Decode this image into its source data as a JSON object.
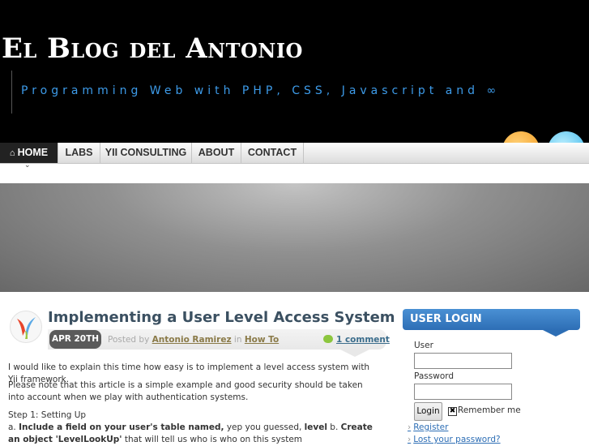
{
  "site": {
    "title": "El Blog del Antonio",
    "tagline": "Programming Web with PHP, CSS, Javascript and ∞"
  },
  "nav": {
    "items": [
      "HOME",
      "LABS",
      "YII CONSULTING",
      "ABOUT",
      "CONTACT"
    ],
    "active": "HOME"
  },
  "post": {
    "title": "Implementing a User Level Access System",
    "date": "APR 20TH",
    "posted_by_label": "Posted by",
    "author": "Antonio Ramirez",
    "in_label": "in",
    "category": "How To",
    "comments": "1 comment",
    "paragraphs": [
      "I would like to explain this time how easy is to implement a level access system with Yii framework.",
      "Please note that this article is a simple example and good security should be taken into account when we play with authentication systems."
    ],
    "step_heading": "Step 1: Setting Up",
    "step_parts": {
      "a_prefix": "a. ",
      "a_bold": "Include a field on your user's table named,",
      "a_text": " yep you guessed, ",
      "a_bold2": "level",
      "b_prefix": " b. ",
      "b_bold": "Create an object 'LevelLookUp'",
      "b_text": " that will tell us who is who on this system"
    }
  },
  "sidebar": {
    "widget_title": "USER LOGIN",
    "user_label": "User",
    "password_label": "Password",
    "user_value": "",
    "password_value": "",
    "login_button": "Login",
    "remember_label": "Remember me",
    "remember_checked": true,
    "links": [
      "Register",
      "Lost your password?"
    ]
  },
  "colors": {
    "accent_blue": "#2d6eb5",
    "tagline_blue": "#3d9be9",
    "header_bg": "#000000"
  }
}
